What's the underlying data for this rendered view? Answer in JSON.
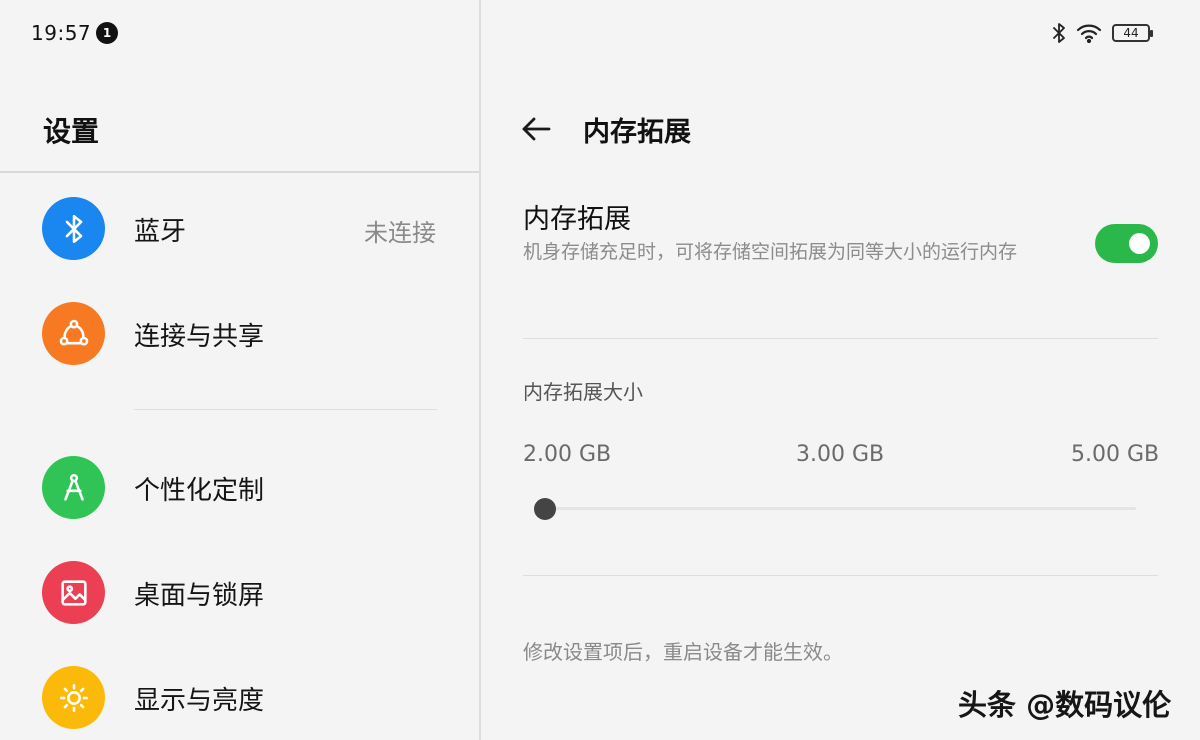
{
  "status_bar": {
    "time": "19:57",
    "notification_count": "1",
    "battery_level": "44",
    "icons": [
      "bluetooth-icon",
      "wifi-icon",
      "battery-icon"
    ]
  },
  "sidebar": {
    "title": "设置",
    "items": [
      {
        "label": "蓝牙",
        "value": "未连接",
        "icon": "bluetooth-icon",
        "color": "#1a86f0"
      },
      {
        "label": "连接与共享",
        "value": "",
        "icon": "share-icon",
        "color": "#f77a23"
      },
      {
        "label": "个性化定制",
        "value": "",
        "icon": "compass-icon",
        "color": "#2fc455"
      },
      {
        "label": "桌面与锁屏",
        "value": "",
        "icon": "image-icon",
        "color": "#ec3f53"
      },
      {
        "label": "显示与亮度",
        "value": "",
        "icon": "sun-icon",
        "color": "#fbba0a"
      }
    ]
  },
  "detail": {
    "title": "内存拓展",
    "switch": {
      "title": "内存拓展",
      "description": "机身存储充足时，可将存储空间拓展为同等大小的运行内存",
      "enabled": true,
      "color": "#2bb84a"
    },
    "size_section": {
      "label": "内存拓展大小",
      "options": [
        "2.00 GB",
        "3.00 GB",
        "5.00 GB"
      ],
      "selected": "2.00 GB"
    },
    "footer_note": "修改设置项后，重启设备才能生效。"
  },
  "watermark": "头条 @数码议伦"
}
